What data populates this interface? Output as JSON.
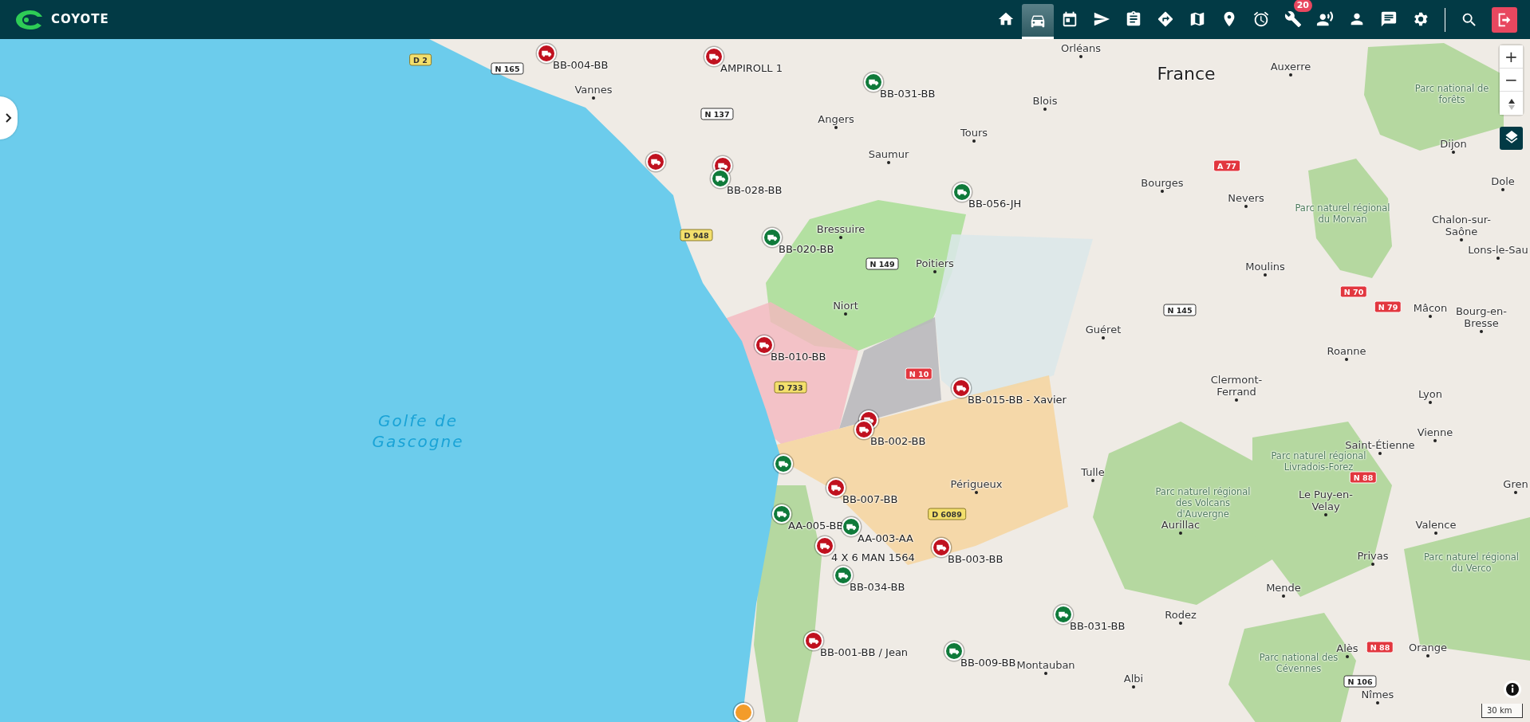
{
  "brand": {
    "name": "COYOTE"
  },
  "nav": [
    {
      "selected": false
    },
    {
      "selected": true
    },
    {
      "selected": false
    },
    {
      "selected": false
    },
    {
      "selected": false
    },
    {
      "selected": false
    },
    {
      "selected": false
    },
    {
      "selected": false
    },
    {
      "selected": false
    },
    {
      "selected": false,
      "badge": "20"
    },
    {
      "selected": false
    },
    {
      "selected": false
    },
    {
      "selected": false
    },
    {
      "selected": false
    }
  ],
  "map": {
    "zoom_in": "+",
    "zoom_out": "−",
    "scale": "30 km",
    "country": "France",
    "sea": "Golfe de Gascogne",
    "cities": [
      "Orléans",
      "Blois",
      "Tours",
      "Angers",
      "Saumur",
      "Vannes",
      "Bressuire",
      "Poitiers",
      "Niort",
      "Guéret",
      "Bourges",
      "Nevers",
      "Auxerre",
      "Dijon",
      "Dole",
      "Chalon-sur-Saône",
      "Lons-le-Sau",
      "Moulins",
      "Mâcon",
      "Bourg-en-Bresse",
      "Roanne",
      "Clermont-Ferrand",
      "Lyon",
      "Vienne",
      "Saint-Étienne",
      "Tulle",
      "Périgueux",
      "Le Puy-en-Velay",
      "Aurillac",
      "Valence",
      "Privas",
      "Mende",
      "Rodez",
      "Alès",
      "Orange",
      "Montauban",
      "Albi",
      "Nîmes",
      "Gren"
    ],
    "parks": [
      "Parc national de forêts",
      "Parc naturel régional du Morvan",
      "Parc naturel régional Livradois-Forez",
      "Parc naturel régional des Volcans d'Auvergne",
      "Parc naturel régional du Verco",
      "Parc national des Cévennes"
    ],
    "roads": [
      {
        "number": "D 2",
        "kind": "departmental"
      },
      {
        "number": "N 165",
        "kind": "national"
      },
      {
        "number": "N 137",
        "kind": "national"
      },
      {
        "number": "D 948",
        "kind": "departmental"
      },
      {
        "number": "N 149",
        "kind": "national"
      },
      {
        "number": "A 77",
        "kind": "motorway"
      },
      {
        "number": "N 70",
        "kind": "motorway"
      },
      {
        "number": "N 79",
        "kind": "motorway"
      },
      {
        "number": "N 145",
        "kind": "national"
      },
      {
        "number": "N 10",
        "kind": "motorway"
      },
      {
        "number": "D 733",
        "kind": "departmental"
      },
      {
        "number": "D 6089",
        "kind": "departmental"
      },
      {
        "number": "N 88",
        "kind": "motorway"
      },
      {
        "number": "N 88",
        "kind": "motorway"
      },
      {
        "number": "N 106",
        "kind": "national"
      }
    ],
    "vehicles": [
      {
        "label": "BB-004-BB",
        "color": "#c0111f"
      },
      {
        "label": "AMPIROLL 1",
        "color": "#c0111f"
      },
      {
        "label": "BB-031-BB",
        "color": "#0f7a3a"
      },
      {
        "color": "#c0111f"
      },
      {
        "color": "#c0111f"
      },
      {
        "label": "BB-028-BB",
        "color": "#0f7a3a"
      },
      {
        "label": "BB-056-JH",
        "color": "#0f7a3a"
      },
      {
        "label": "BB-020-BB",
        "color": "#0f7a3a"
      },
      {
        "label": "BB-010-BB",
        "color": "#c0111f"
      },
      {
        "label": "BB-015-BB - Xavier",
        "color": "#c0111f"
      },
      {
        "color": "#c0111f"
      },
      {
        "label": "BB-002-BB",
        "color": "#c0111f"
      },
      {
        "color": "#0f7a3a"
      },
      {
        "label": "BB-007-BB",
        "color": "#c0111f"
      },
      {
        "label": "AA-005-BB",
        "color": "#0f7a3a"
      },
      {
        "label": "AA-003-AA",
        "color": "#0f7a3a"
      },
      {
        "label": "4 X 6 MAN 1564",
        "color": "#c0111f"
      },
      {
        "label": "BB-003-BB",
        "color": "#c0111f"
      },
      {
        "label": "BB-034-BB",
        "color": "#0f7a3a"
      },
      {
        "label": "BB-031-BB",
        "color": "#0f7a3a"
      },
      {
        "label": "BB-001-BB / Jean",
        "color": "#c0111f"
      },
      {
        "label": "BB-009-BB",
        "color": "#0f7a3a"
      }
    ]
  }
}
